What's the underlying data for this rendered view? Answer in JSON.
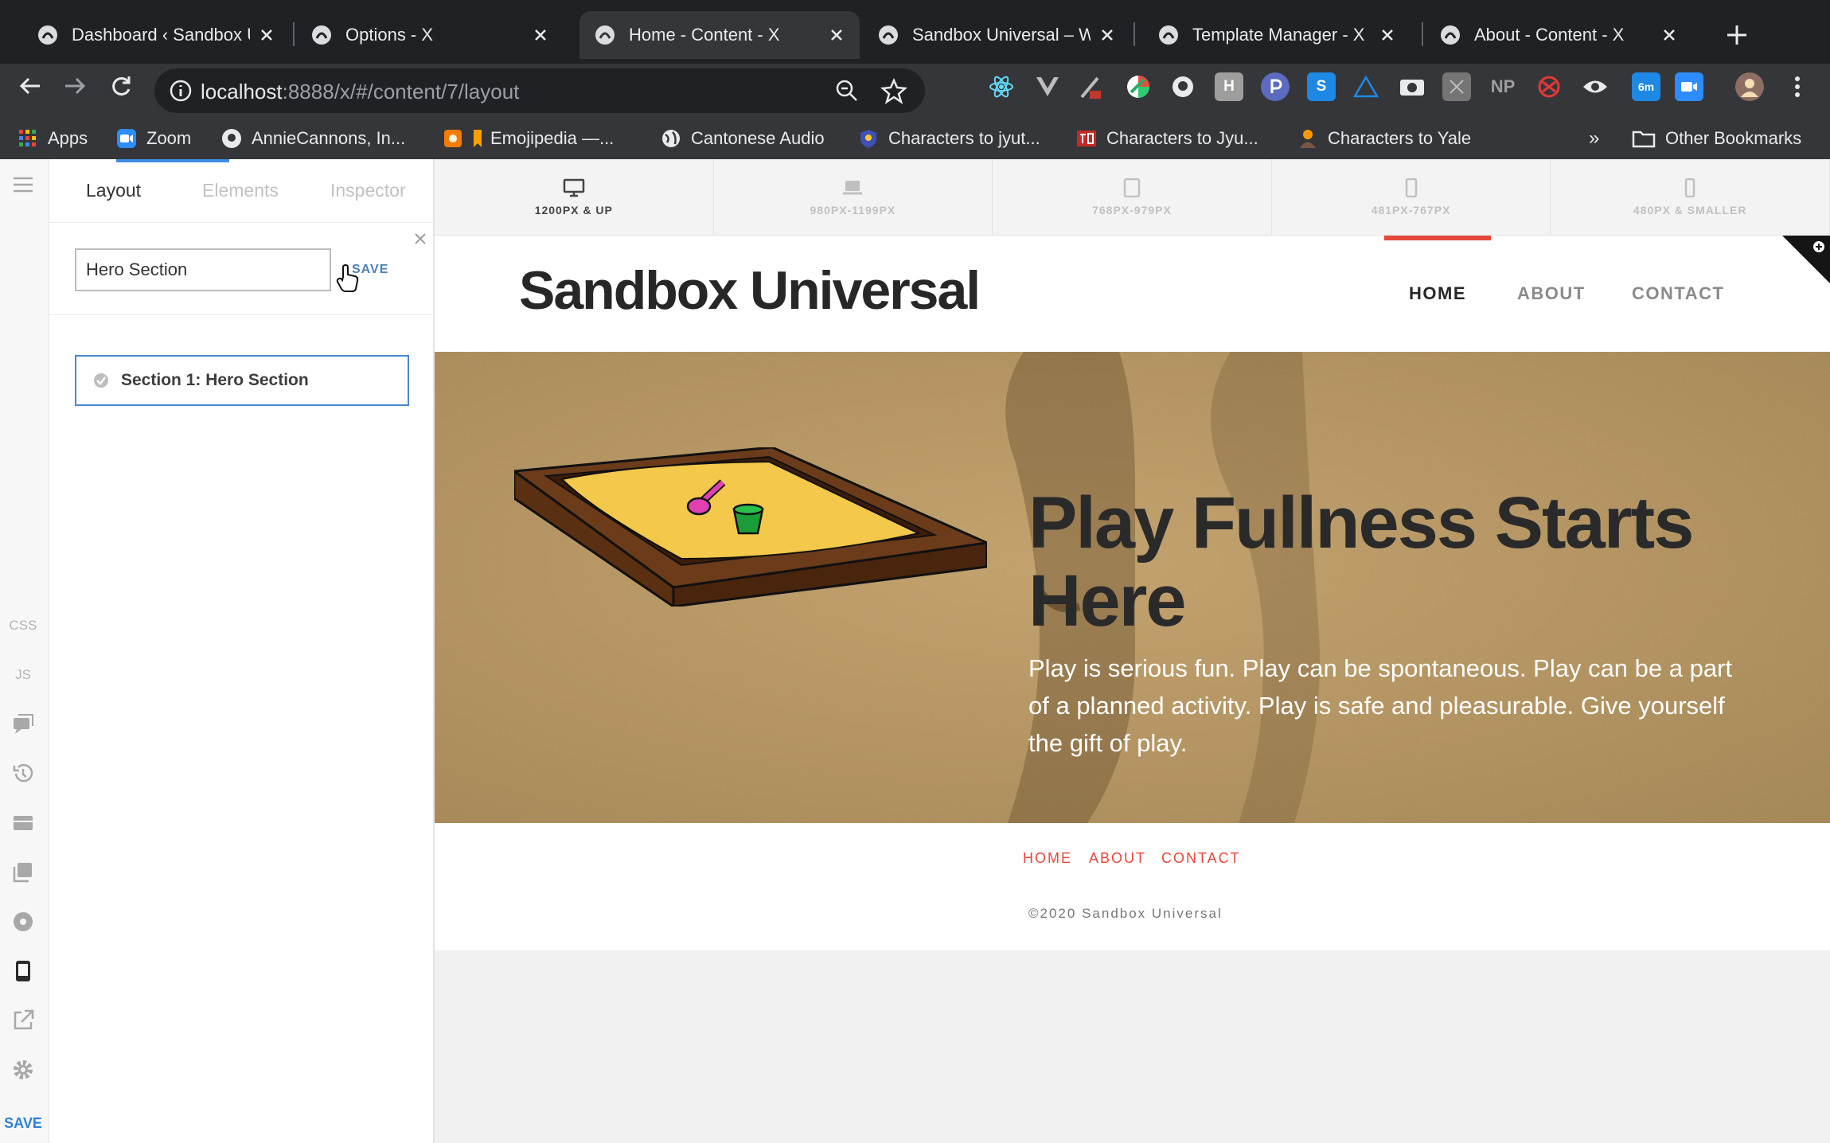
{
  "browser": {
    "tabs": [
      {
        "title": "Dashboard ‹ Sandbox U"
      },
      {
        "title": "Options - X"
      },
      {
        "title": "Home - Content - X"
      },
      {
        "title": "Sandbox Universal – W"
      },
      {
        "title": "Template Manager - X"
      },
      {
        "title": "About - Content - X"
      }
    ],
    "url_host": "localhost",
    "url_rest": ":8888/x/#/content/7/layout",
    "extensions": [
      "react-icon",
      "vue-icon",
      "paint-icon",
      "color-icon",
      "github-icon",
      "H",
      "p-icon",
      "S",
      "triangle-icon",
      "camera-icon",
      "box-icon",
      "NP",
      "swirl-icon",
      "eye-icon",
      "6m",
      "zoom-icon"
    ],
    "bookmarks": [
      {
        "label": "Apps"
      },
      {
        "label": "Zoom"
      },
      {
        "label": "AnnieCannons, In..."
      },
      {
        "label": "Emojipedia —..."
      },
      {
        "label": "Cantonese Audio"
      },
      {
        "label": "Characters to jyut..."
      },
      {
        "label": "Characters to Jyu..."
      },
      {
        "label": "Characters to Yale"
      }
    ],
    "bookmarks_more": "»",
    "other_bookmarks": "Other Bookmarks"
  },
  "rail": {
    "css_label": "CSS",
    "js_label": "JS",
    "save_label": "SAVE"
  },
  "panel": {
    "tabs": [
      "Layout",
      "Elements",
      "Inspector"
    ],
    "active_tab": "Layout",
    "rename_value": "Hero Section",
    "rename_save": "SAVE",
    "section_label": "Section 1: Hero Section"
  },
  "breakpoints": [
    {
      "label": "1200PX & UP",
      "icon": "desktop-icon"
    },
    {
      "label": "980PX-1199PX",
      "icon": "laptop-icon"
    },
    {
      "label": "768PX-979PX",
      "icon": "tablet-icon"
    },
    {
      "label": "481PX-767PX",
      "icon": "tablet-small-icon"
    },
    {
      "label": "480PX & SMALLER",
      "icon": "phone-icon"
    }
  ],
  "site": {
    "title": "Sandbox Universal",
    "nav": [
      "HOME",
      "ABOUT",
      "CONTACT"
    ],
    "hero_title": "Play Fullness Starts Here",
    "hero_text": "Play is serious fun. Play can be spontaneous. Play can be a part of a planned activity. Play is safe and pleasurable. Give yourself the gift of play.",
    "footer_nav": [
      "HOME",
      "ABOUT",
      "CONTACT"
    ],
    "copyright": "©2020 Sandbox Universal"
  },
  "colors": {
    "accent_red": "#e6473b",
    "selection_blue": "#4a87d4"
  }
}
